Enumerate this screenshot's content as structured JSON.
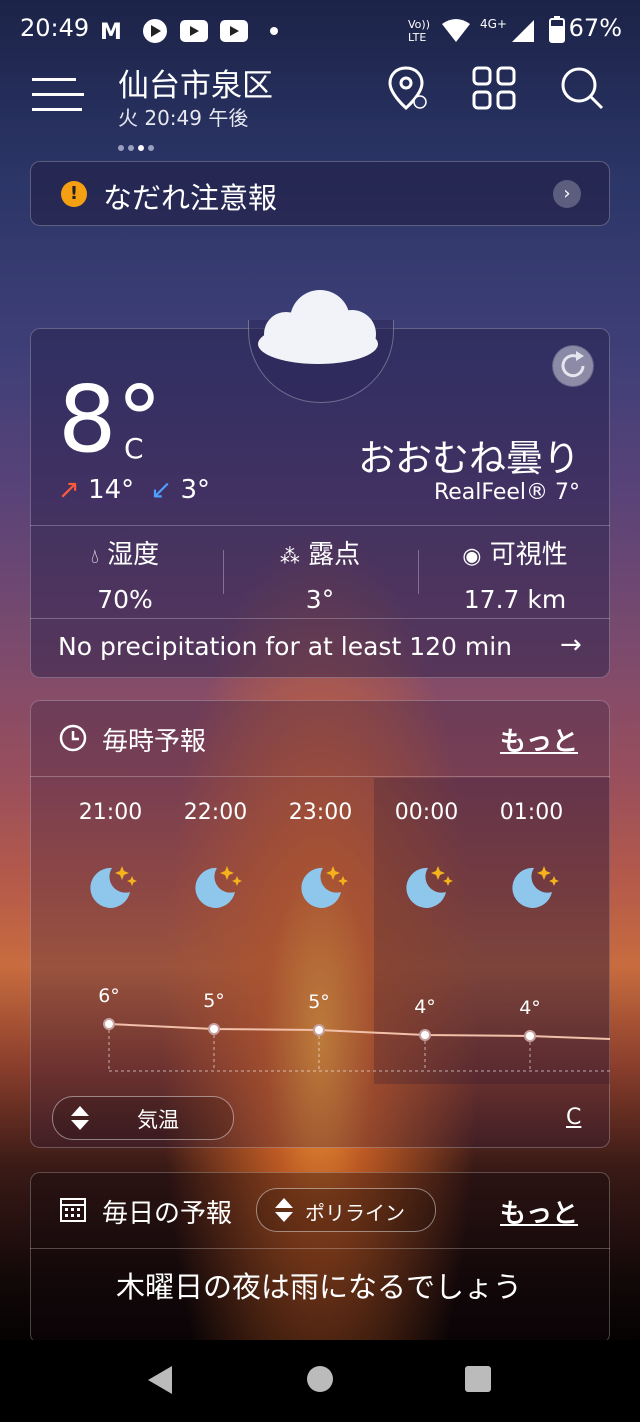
{
  "status": {
    "time": "20:49",
    "battery": "67%",
    "network": "4G+",
    "volte": "Vo LTE"
  },
  "header": {
    "city": "仙台市泉区",
    "datetime": "火 20:49 午後"
  },
  "alert": {
    "text": "なだれ注意報"
  },
  "current": {
    "temp": "8°",
    "unit": "C",
    "high": "14°",
    "low": "3°",
    "condition": "おおむね曇り",
    "realfeel": "RealFeel® 7°",
    "humidity_label": "湿度",
    "humidity": "70%",
    "dewpoint_label": "露点",
    "dewpoint": "3°",
    "visibility_label": "可視性",
    "visibility": "17.7 km",
    "precip": "No precipitation for at least 120 min"
  },
  "hourly": {
    "title": "毎時予報",
    "more": "もっと",
    "hours": [
      {
        "time": "21:00",
        "temp": "6°"
      },
      {
        "time": "22:00",
        "temp": "5°"
      },
      {
        "time": "23:00",
        "temp": "5°"
      },
      {
        "time": "00:00",
        "temp": "4°"
      },
      {
        "time": "01:00",
        "temp": "4°"
      }
    ],
    "toggle": "気温",
    "unit_link": "C"
  },
  "daily": {
    "title": "毎日の予報",
    "toggle": "ポリライン",
    "more": "もっと",
    "headline": "木曜日の夜は雨になるでしょう"
  }
}
